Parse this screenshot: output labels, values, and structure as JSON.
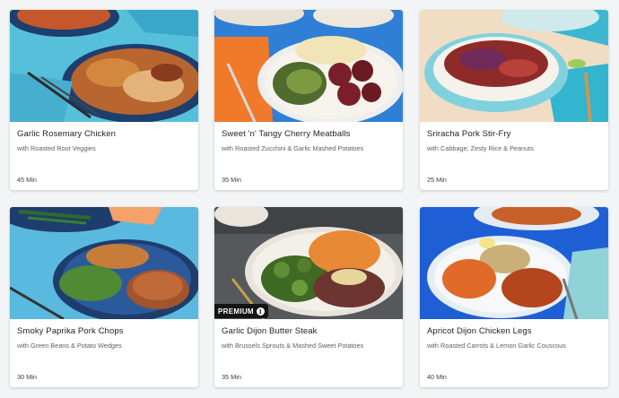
{
  "recipes": [
    {
      "title": "Garlic Rosemary Chicken",
      "subtitle": "with Roasted Root Veggies",
      "time": "45 Min"
    },
    {
      "title": "Sweet 'n' Tangy Cherry Meatballs",
      "subtitle": "with Roasted Zucchini & Garlic Mashed Potatoes",
      "time": "35 Min"
    },
    {
      "title": "Sriracha Pork Stir-Fry",
      "subtitle": "with Cabbage, Zesty Rice & Peanuts",
      "time": "25 Min"
    },
    {
      "title": "Smoky Paprika Pork Chops",
      "subtitle": "with Green Beans & Potato Wedges",
      "time": "30 Min"
    },
    {
      "title": "Garlic Dijon Butter Steak",
      "subtitle": "with Brussels Sprouts & Mashed Sweet Potatoes",
      "time": "35 Min",
      "badge": "PREMIUM",
      "badge_icon": "info-icon"
    },
    {
      "title": "Apricot Dijon Chicken Legs",
      "subtitle": "with Roasted Carrots & Lemon Garlic Couscous",
      "time": "40 Min"
    }
  ],
  "colors": {
    "page_bg": "#f2f4f5",
    "card_bg": "#ffffff",
    "title": "#232323",
    "subtitle": "#5f5f5f",
    "badge_bg": "#141414"
  }
}
